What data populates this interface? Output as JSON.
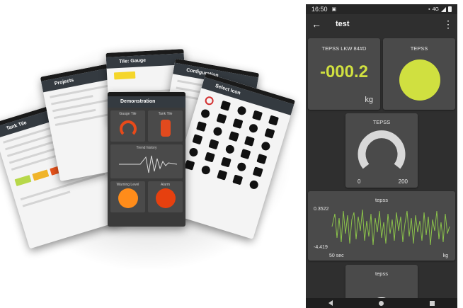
{
  "collage": {
    "screens": [
      {
        "title": "Tank Tile"
      },
      {
        "title": "Projects"
      },
      {
        "title": "Tile: Gauge"
      },
      {
        "title": "Configuration"
      },
      {
        "title": "Select Icon"
      },
      {
        "title": "Demonstration"
      }
    ],
    "demo_tiles": [
      "Gauge Tile",
      "Tank Tile",
      "Trend history",
      "Warning Level",
      "Alarm"
    ]
  },
  "phone": {
    "status": {
      "time": "16:50",
      "network": "4G"
    },
    "appbar": {
      "title": "test"
    },
    "tiles": {
      "weight": {
        "title": "TEPSS LKW 84#D",
        "value": "-000.2",
        "unit": "kg"
      },
      "indicator": {
        "title": "TEPSS",
        "color": "#d0e040"
      },
      "gauge": {
        "title": "TEPSS",
        "min": "0",
        "max": "200"
      },
      "trend": {
        "title": "tepss",
        "ymax": "0.3522",
        "ymin": "-4.419",
        "xlabel": "50 sec",
        "unit": "kg"
      },
      "partial": {
        "title": "tepss"
      }
    }
  }
}
